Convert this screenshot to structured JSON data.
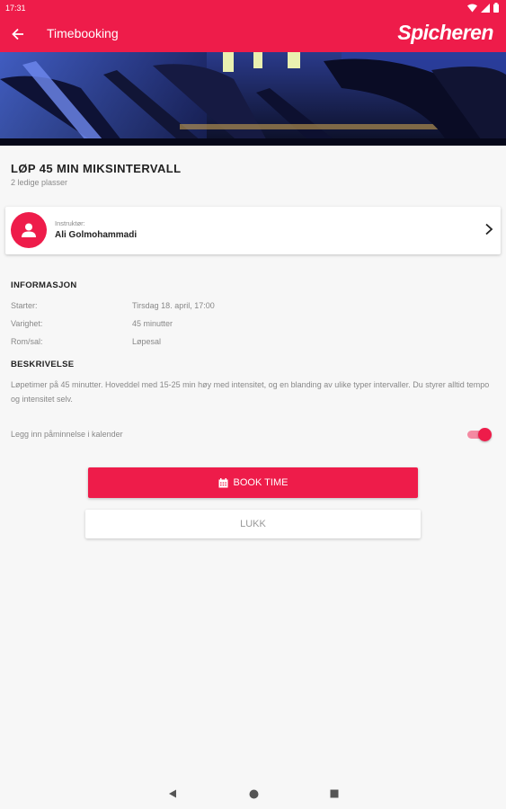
{
  "status_bar": {
    "time": "17:31",
    "icons": [
      "wifi-icon",
      "signal-icon",
      "battery-icon"
    ]
  },
  "app_bar": {
    "title": "Timebooking",
    "brand": "Spicheren",
    "back_icon": "arrow-back-icon"
  },
  "class": {
    "title": "LØP 45 MIN MIKSINTERVALL",
    "spots": "2 ledige plasser"
  },
  "instructor": {
    "label": "Instruktør:",
    "name": "Ali Golmohammadi",
    "avatar_icon": "person-icon"
  },
  "info": {
    "heading": "INFORMASJON",
    "rows": [
      {
        "key": "Starter:",
        "value": "Tirsdag 18. april, 17:00"
      },
      {
        "key": "Varighet:",
        "value": "45 minutter"
      },
      {
        "key": "Rom/sal:",
        "value": "Løpesal"
      }
    ]
  },
  "description": {
    "heading": "BESKRIVELSE",
    "text": "Løpetimer på 45 minutter. Hoveddel med 15-25 min høy med intensitet, og en blanding av ulike typer intervaller. Du styrer alltid tempo og intensitet selv."
  },
  "reminder": {
    "label": "Legg inn påminnelse i kalender",
    "enabled": true
  },
  "buttons": {
    "book_label": "BOOK TIME",
    "close_label": "LUKK"
  },
  "colors": {
    "accent": "#ee1c4a",
    "background": "#f7f7f7"
  }
}
